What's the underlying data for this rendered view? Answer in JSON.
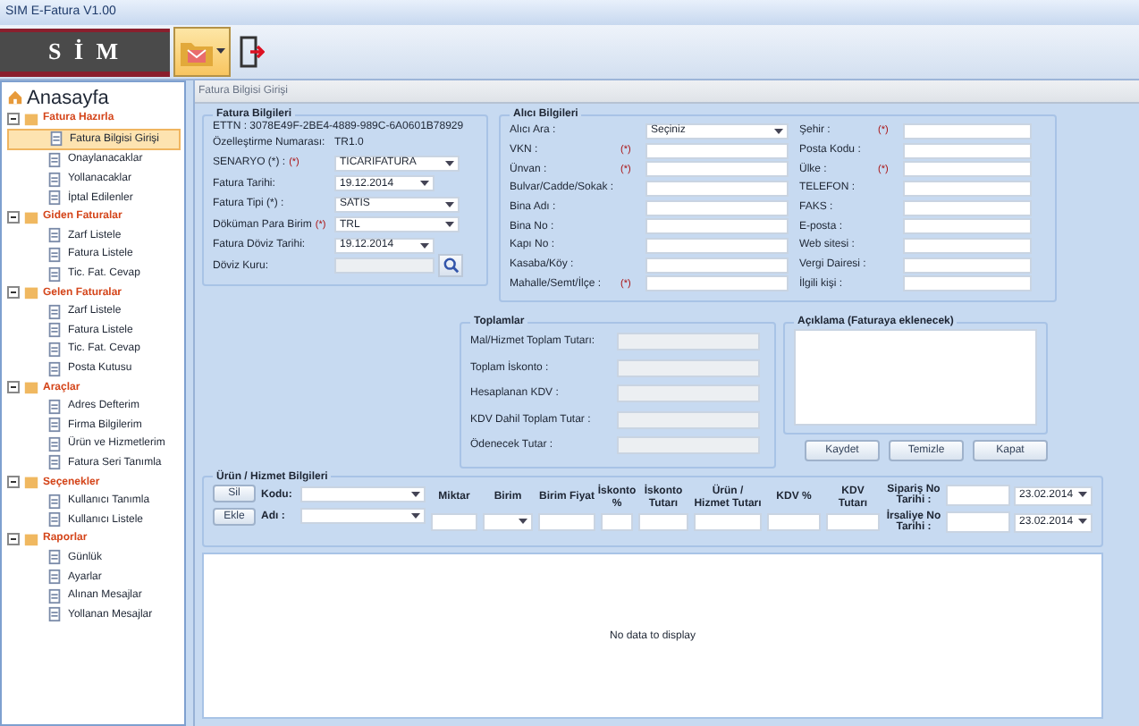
{
  "window": {
    "title": "SIM E-Fatura V1.00"
  },
  "header": {
    "logo": "S İ M"
  },
  "tree": [
    {
      "label": "Anasayfa",
      "kind": "home",
      "selected": false
    },
    {
      "label": "Fatura Hazırla",
      "kind": "group",
      "expanded": true,
      "children": [
        {
          "label": "Fatura Bilgisi Girişi",
          "selected": true
        },
        {
          "label": "Onaylanacaklar",
          "selected": false
        },
        {
          "label": "Yollanacaklar",
          "selected": false
        },
        {
          "label": "İptal Edilenler",
          "selected": false
        }
      ]
    },
    {
      "label": "Giden Faturalar",
      "kind": "group",
      "expanded": true,
      "children": [
        {
          "label": "Zarf Listele",
          "selected": false
        },
        {
          "label": "Fatura  Listele",
          "selected": false
        },
        {
          "label": "Tic. Fat. Cevap",
          "selected": false
        }
      ]
    },
    {
      "label": "Gelen Faturalar",
      "kind": "group",
      "expanded": true,
      "children": [
        {
          "label": "Zarf Listele",
          "selected": false
        },
        {
          "label": "Fatura Listele",
          "selected": false
        },
        {
          "label": "Tic. Fat. Cevap",
          "selected": false
        },
        {
          "label": "Posta Kutusu",
          "selected": false
        }
      ]
    },
    {
      "label": "Araçlar",
      "kind": "group",
      "expanded": true,
      "children": [
        {
          "label": "Adres Defterim",
          "selected": false
        },
        {
          "label": "Firma Bilgilerim",
          "selected": false
        },
        {
          "label": "Ürün ve Hizmetlerim",
          "selected": false
        },
        {
          "label": "Fatura Seri Tanımla",
          "selected": false
        }
      ]
    },
    {
      "label": "Seçenekler",
      "kind": "group",
      "expanded": true,
      "children": [
        {
          "label": "Kullanıcı Tanımla",
          "selected": false
        },
        {
          "label": "Kullanıcı Listele",
          "selected": false
        }
      ]
    },
    {
      "label": "Raporlar",
      "kind": "group",
      "expanded": true,
      "children": [
        {
          "label": "Günlük",
          "selected": false
        },
        {
          "label": "Ayarlar",
          "selected": false
        },
        {
          "label": "Alınan Mesajlar",
          "selected": false
        },
        {
          "label": "Yollanan Mesajlar",
          "selected": false
        }
      ]
    }
  ],
  "tab": {
    "title": "Fatura Bilgisi Girişi"
  },
  "fatura_bilgileri": {
    "title": "Fatura Bilgileri",
    "ettn": "ETTN :  3078E49F-2BE4-4889-989C-6A0601B78929",
    "ozellestirme_label": "Özelleştirme Numarası:",
    "ozellestirme_value": "TR1.0",
    "fields": [
      {
        "label": "SENARYO (*) :",
        "required": "(*)",
        "kind": "select",
        "value": "TICARIFATURA"
      },
      {
        "label": "Fatura Tarihi:",
        "kind": "date",
        "value": "19.12.2014"
      },
      {
        "label": "Fatura Tipi (*) :",
        "kind": "select",
        "value": "SATIS"
      },
      {
        "label": "Döküman Para Birim",
        "required": "(*)",
        "kind": "select",
        "value": "TRL"
      },
      {
        "label": "Fatura Döviz Tarihi:",
        "kind": "date",
        "value": "19.12.2014"
      },
      {
        "label": "Döviz Kuru:",
        "kind": "lookup"
      }
    ]
  },
  "alici_bilgileri": {
    "title": "Alıcı Bilgileri",
    "left": [
      {
        "label": "Alıcı Ara :",
        "kind": "select",
        "value": "Seçiniz"
      },
      {
        "label": "VKN :",
        "required": "(*)",
        "kind": "text"
      },
      {
        "label": "Ünvan :",
        "required": "(*)",
        "kind": "text"
      },
      {
        "label": "Bulvar/Cadde/Sokak :",
        "kind": "text"
      },
      {
        "label": "Bina Adı :",
        "kind": "text"
      },
      {
        "label": "Bina No :",
        "kind": "text"
      },
      {
        "label": "Kapı No :",
        "kind": "text"
      },
      {
        "label": "Kasaba/Köy :",
        "kind": "text"
      },
      {
        "label": "Mahalle/Semt/İlçe :",
        "required": "(*)",
        "kind": "text"
      }
    ],
    "right": [
      {
        "label": "Şehir :",
        "required": "(*)",
        "kind": "text"
      },
      {
        "label": "Posta Kodu :",
        "kind": "text"
      },
      {
        "label": "Ülke :",
        "required": "(*)",
        "kind": "text"
      },
      {
        "label": "TELEFON :",
        "kind": "text"
      },
      {
        "label": "FAKS :",
        "kind": "text"
      },
      {
        "label": "E-posta :",
        "kind": "text"
      },
      {
        "label": "Web sitesi :",
        "kind": "text"
      },
      {
        "label": "Vergi Dairesi :",
        "kind": "text"
      },
      {
        "label": "İlgili kişi :",
        "kind": "text"
      }
    ]
  },
  "toplamlar": {
    "title": "Toplamlar",
    "fields": [
      "Mal/Hizmet Toplam Tutarı:",
      "Toplam İskonto :",
      "Hesaplanan KDV :",
      "KDV Dahil Toplam Tutar :",
      "Ödenecek Tutar :"
    ]
  },
  "aciklama": {
    "title": "Açıklama (Faturaya eklenecek)"
  },
  "buttons": [
    "Kaydet",
    "Temizle",
    "Kapat"
  ],
  "urun_hizmet": {
    "title": "Ürün / Hizmet Bilgileri",
    "buttons": [
      "Sil",
      "Ekle"
    ],
    "kodu_label": "Kodu:",
    "adi_label": "Adı :",
    "columns": [
      {
        "label": "Miktar",
        "kind": "text"
      },
      {
        "label": "Birim",
        "kind": "select"
      },
      {
        "label": "Birim Fiyat",
        "kind": "text"
      },
      {
        "label": "İskonto %",
        "kind": "text"
      },
      {
        "label": "İskonto Tutarı",
        "kind": "text"
      },
      {
        "label": "Ürün / Hizmet Tutarı",
        "kind": "text"
      },
      {
        "label": "KDV %",
        "kind": "text"
      },
      {
        "label": "KDV Tutarı",
        "kind": "text"
      }
    ],
    "dates": [
      {
        "label": "Sipariş No Tarihi :",
        "value": "23.02.2014"
      },
      {
        "label": "İrsaliye No Tarihi :",
        "value": "23.02.2014"
      }
    ]
  },
  "grid": {
    "empty_text": "No data to display"
  }
}
